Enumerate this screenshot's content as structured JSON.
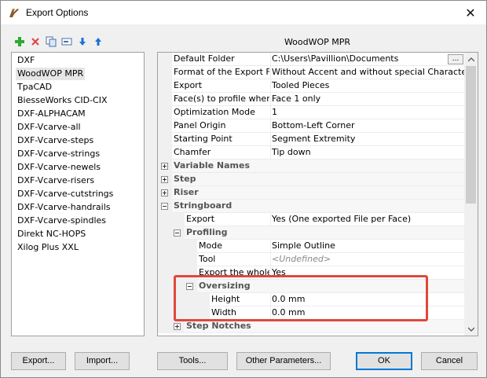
{
  "window": {
    "title": "Export Options",
    "close_label": "✕"
  },
  "section_title": "WoodWOP MPR",
  "formats": [
    "DXF",
    "WoodWOP MPR",
    "TpaCAD",
    "BiesseWorks CID-CIX",
    "DXF-ALPHACAM",
    "DXF-Vcarve-all",
    "DXF-Vcarve-steps",
    "DXF-Vcarve-strings",
    "DXF-Vcarve-newels",
    "DXF-Vcarve-risers",
    "DXF-Vcarve-cutstrings",
    "DXF-Vcarve-handrails",
    "DXF-Vcarve-spindles",
    "Direkt NC-HOPS",
    "Xilog Plus XXL"
  ],
  "selected_format_index": 1,
  "properties": [
    {
      "name": "Default Folder",
      "value": "C:\\Users\\Pavillion\\Documents",
      "kind": "prop",
      "level": 0,
      "has_button": true,
      "button_label": "..."
    },
    {
      "name": "Format of the Export Fil...",
      "value": "Without Accent and without special Characters",
      "kind": "prop",
      "level": 0
    },
    {
      "name": "Export",
      "value": "Tooled Pieces",
      "kind": "prop",
      "level": 0
    },
    {
      "name": "Face(s) to profile when t...",
      "value": "Face 1 only",
      "kind": "prop",
      "level": 0
    },
    {
      "name": "Optimization Mode",
      "value": "1",
      "kind": "prop",
      "level": 0
    },
    {
      "name": "Panel Origin",
      "value": "Bottom-Left Corner",
      "kind": "prop",
      "level": 0
    },
    {
      "name": "Starting Point",
      "value": "Segment Extremity",
      "kind": "prop",
      "level": 0
    },
    {
      "name": "Chamfer",
      "value": "Tip down",
      "kind": "prop",
      "level": 0
    },
    {
      "name": "Variable Names",
      "kind": "cat",
      "level": 0,
      "expanded": false
    },
    {
      "name": "Step",
      "kind": "cat",
      "level": 0,
      "expanded": false
    },
    {
      "name": "Riser",
      "kind": "cat",
      "level": 0,
      "expanded": false
    },
    {
      "name": "Stringboard",
      "kind": "cat",
      "level": 0,
      "expanded": true
    },
    {
      "name": "Export",
      "value": "Yes (One exported File per Face)",
      "kind": "prop",
      "level": 1
    },
    {
      "name": "Profiling",
      "kind": "cat",
      "level": 1,
      "expanded": true
    },
    {
      "name": "Mode",
      "value": "Simple Outline",
      "kind": "prop",
      "level": 2
    },
    {
      "name": "Tool",
      "value": "<Undefined>",
      "kind": "prop",
      "level": 2,
      "undefined": true
    },
    {
      "name": "Export the whole ...",
      "value": "Yes",
      "kind": "prop",
      "level": 2
    },
    {
      "name": "Oversizing",
      "kind": "cat",
      "level": 2,
      "expanded": true
    },
    {
      "name": "Height",
      "value": "0.0 mm",
      "kind": "prop",
      "level": 3
    },
    {
      "name": "Width",
      "value": "0.0 mm",
      "kind": "prop",
      "level": 3
    },
    {
      "name": "Step Notches",
      "kind": "cat",
      "level": 1,
      "expanded": false
    }
  ],
  "buttons": {
    "export": "Export...",
    "import": "Import...",
    "tools": "Tools...",
    "other_parameters": "Other Parameters...",
    "ok": "OK",
    "cancel": "Cancel"
  },
  "toolbar_icons": [
    "add-icon",
    "delete-icon",
    "copy-icon",
    "rename-icon",
    "move-down-icon",
    "move-up-icon"
  ],
  "colors": {
    "accent": "#0078d7",
    "highlight_box": "#e1473b",
    "add_green": "#2eaa2e",
    "delete_red": "#e04848",
    "arrow_blue": "#1e6fd9"
  }
}
